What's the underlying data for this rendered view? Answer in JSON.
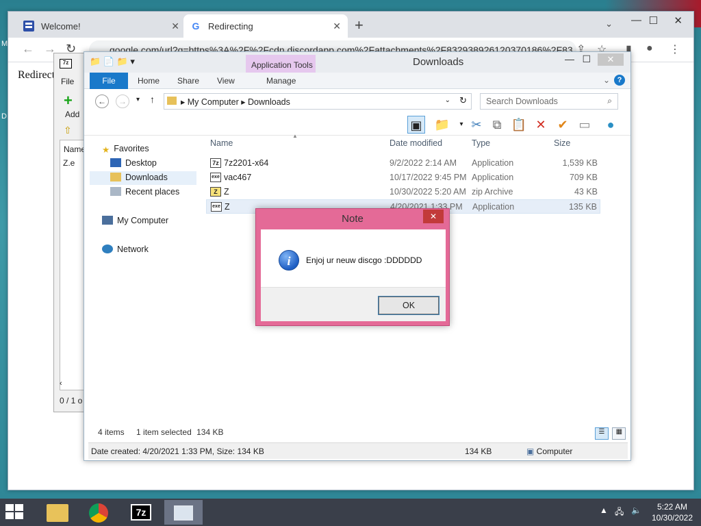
{
  "desktop": {
    "left_label_top": "M",
    "left_label_mid": "D"
  },
  "chrome": {
    "tabs": [
      {
        "title": "Welcome!",
        "close": "✕"
      },
      {
        "title": "Redirecting",
        "close": "✕"
      }
    ],
    "new_tab": "+",
    "address": "google.com/url?q=https%3A%2F%2Fcdn.discordapp.com%2Fattachments%2F83293892612037018​6%2F83",
    "page_text": "Redirect"
  },
  "sevenzip": {
    "icon": "7z",
    "menu_file": "File",
    "add_label": "Add",
    "col_name": "Name",
    "item": "Z.e",
    "status": "0 / 1 o"
  },
  "explorer": {
    "title": "Downloads",
    "context_tab": "Application Tools",
    "ribbon_tabs": [
      "File",
      "Home",
      "Share",
      "View",
      "Manage"
    ],
    "breadcrumb": [
      "My Computer",
      "Downloads"
    ],
    "search_placeholder": "Search Downloads",
    "nav": {
      "favorites": "Favorites",
      "desktop": "Desktop",
      "downloads": "Downloads",
      "recent": "Recent places",
      "computer": "My Computer",
      "network": "Network"
    },
    "columns": {
      "name": "Name",
      "date": "Date modified",
      "type": "Type",
      "size": "Size"
    },
    "files": [
      {
        "name": "7z2201-x64",
        "date": "9/2/2022 2:14 AM",
        "type": "Application",
        "size": "1,539 KB",
        "icon": "7z"
      },
      {
        "name": "vac467",
        "date": "10/17/2022 9:45 PM",
        "type": "Application",
        "size": "709 KB",
        "icon": "exe"
      },
      {
        "name": "Z",
        "date": "10/30/2022 5:20 AM",
        "type": "zip Archive",
        "size": "43 KB",
        "icon": "Z"
      },
      {
        "name": "Z",
        "date": "4/20/2021 1:33 PM",
        "type": "Application",
        "size": "135 KB",
        "icon": "exe"
      }
    ],
    "status_items": "4 items",
    "status_selected": "1 item selected",
    "status_size": "134 KB",
    "details": "Date created: 4/20/2021 1:33 PM, Size: 134 KB",
    "details_size": "134 KB",
    "details_location": "Computer"
  },
  "dialog": {
    "title": "Note",
    "close": "✕",
    "message": "Enjoj ur neuw discgo :DDDDDD",
    "ok": "OK"
  },
  "taskbar": {
    "time": "5:22 AM",
    "date": "10/30/2022"
  }
}
